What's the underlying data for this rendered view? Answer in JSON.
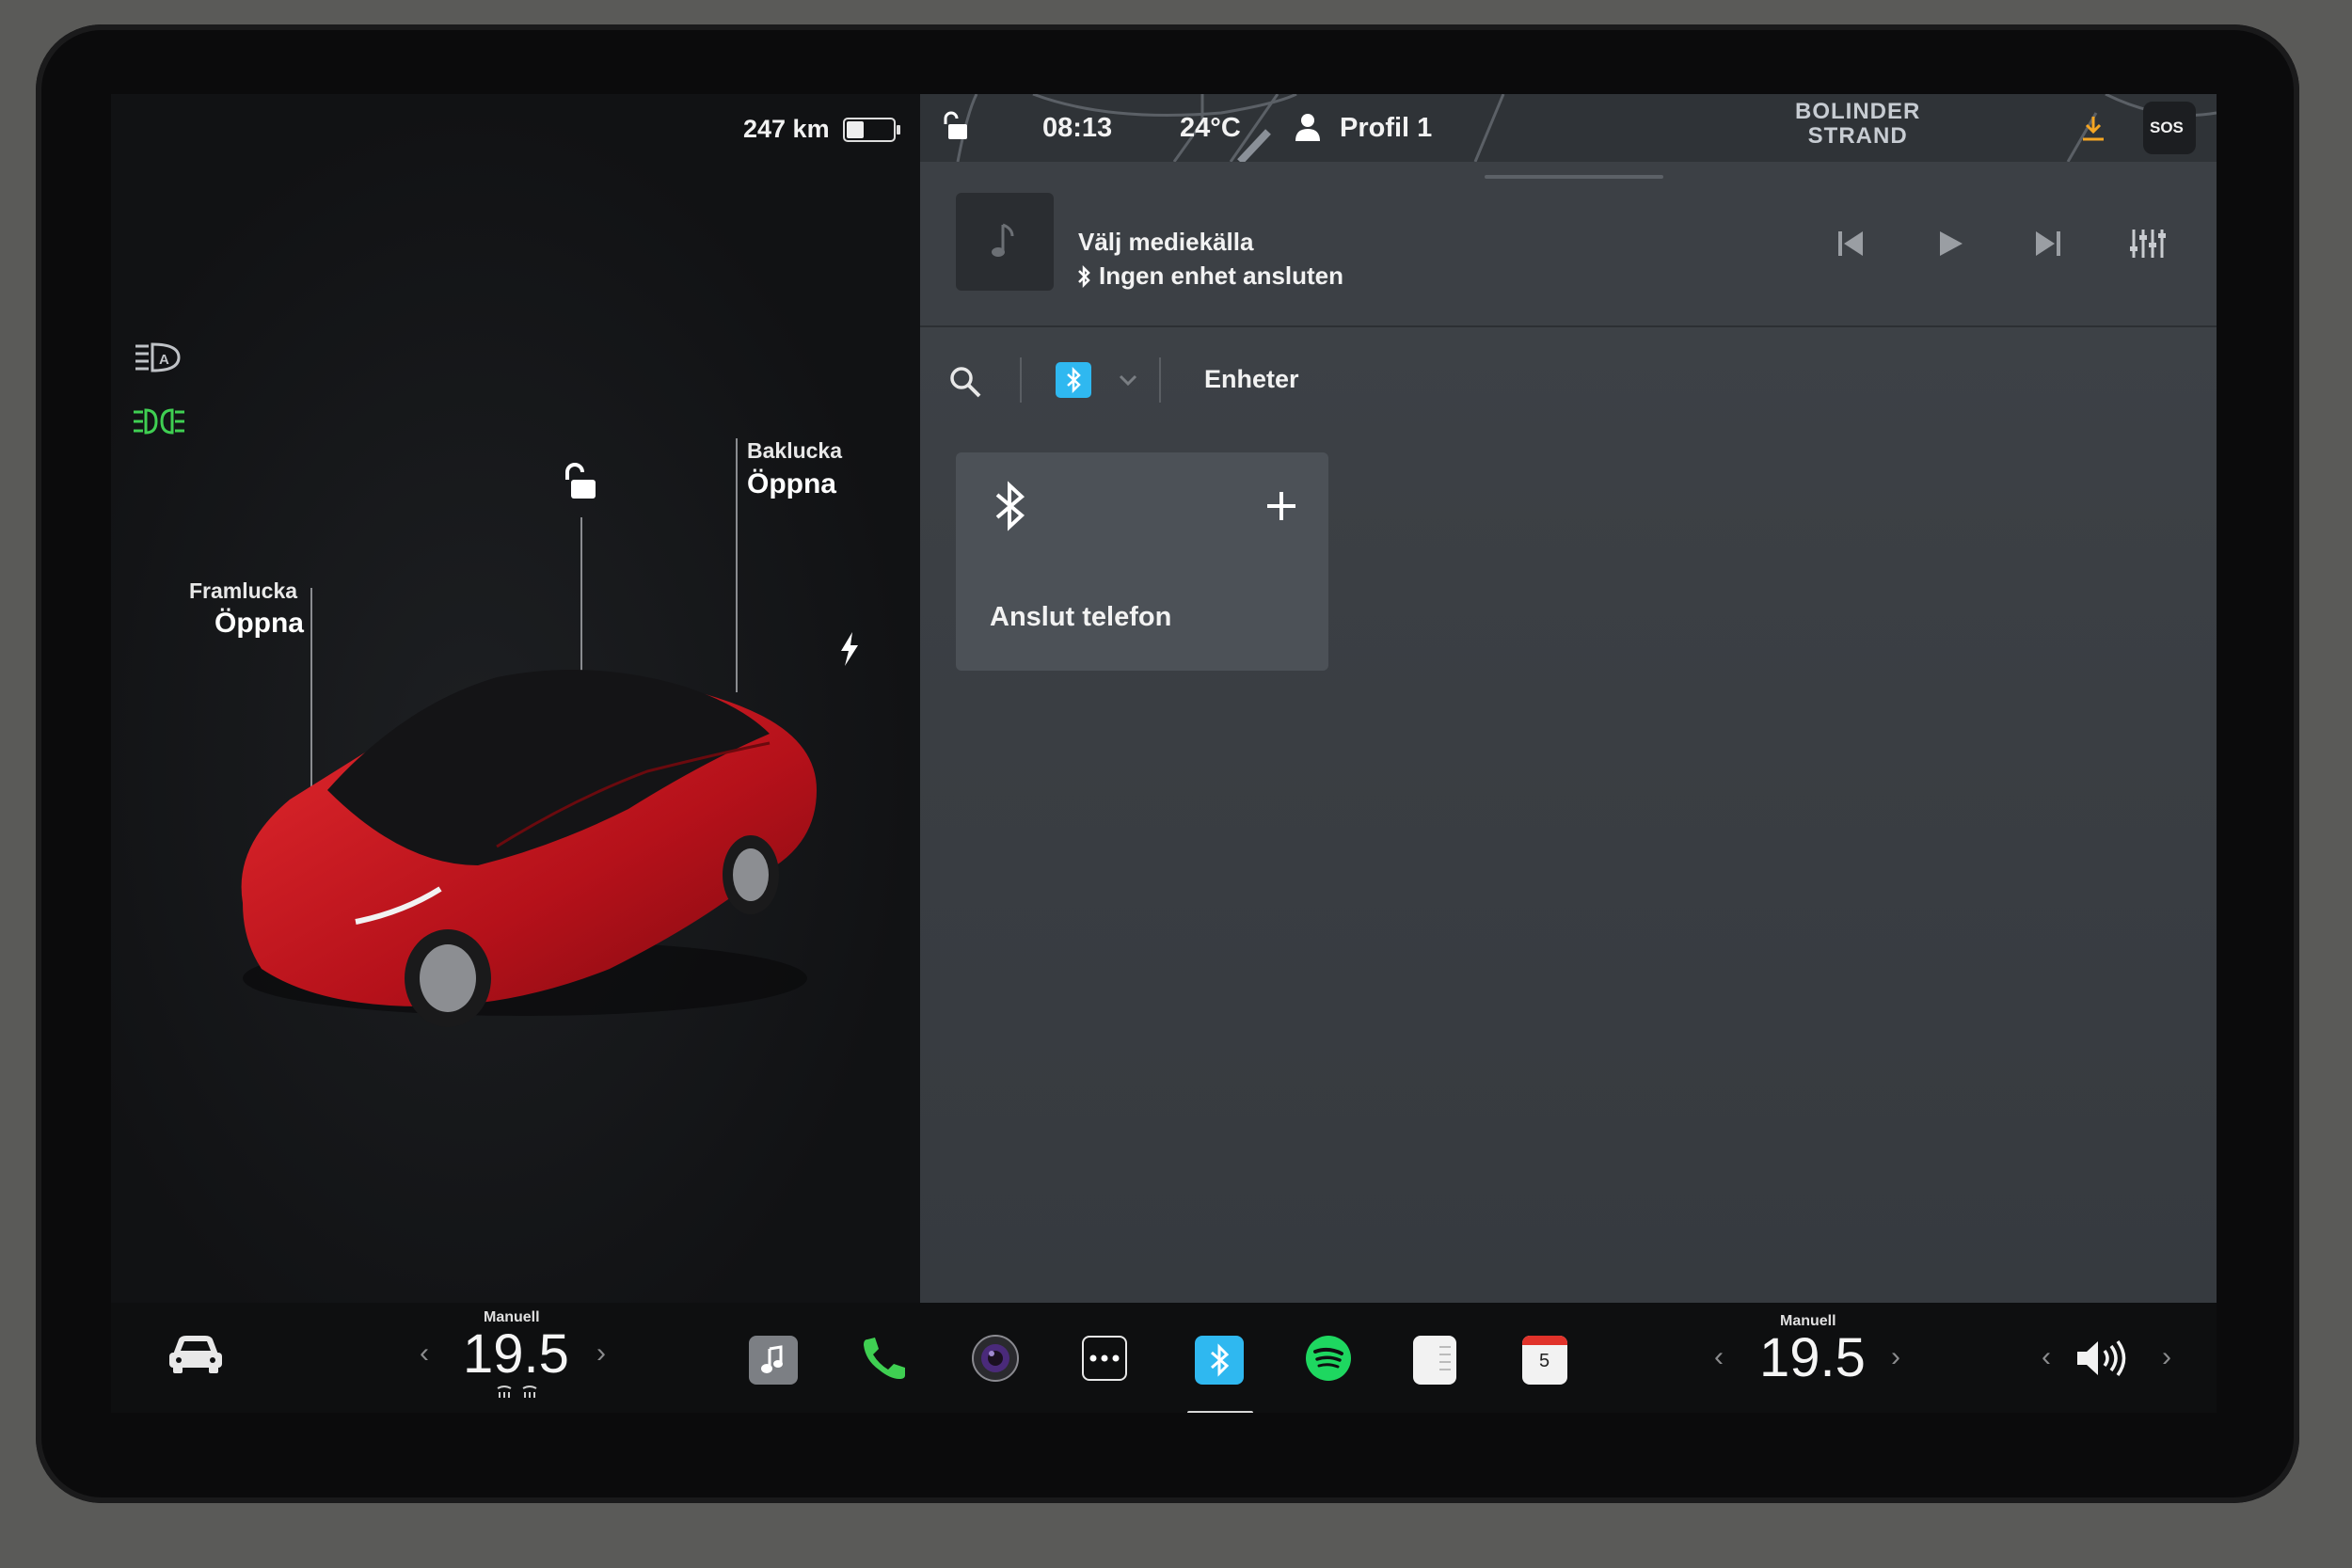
{
  "status_bar": {
    "range": "247 km",
    "battery_level": 0.4,
    "time": "08:13",
    "temperature": "24°C",
    "profile": "Profil 1",
    "map_label_line1": "BOLINDER",
    "map_label_line2": "STRAND",
    "sos_label": "SOS"
  },
  "car_panel": {
    "frunk_label": "Framlucka",
    "frunk_action": "Öppna",
    "trunk_label": "Baklucka",
    "trunk_action": "Öppna"
  },
  "media": {
    "title": "Välj mediekälla",
    "subtitle": "Ingen enhet ansluten"
  },
  "source_tabs": {
    "devices_tab": "Enheter"
  },
  "connect_card": {
    "label": "Anslut telefon"
  },
  "climate_left": {
    "mode": "Manuell",
    "temp": "19.5"
  },
  "climate_right": {
    "mode": "Manuell",
    "temp": "19.5"
  },
  "dock": {
    "calendar_day": "5"
  },
  "colors": {
    "accent_green": "#3fcf52",
    "bluetooth_blue": "#2fb8f0",
    "car_red": "#c8141b",
    "download_orange": "#f5a623"
  }
}
